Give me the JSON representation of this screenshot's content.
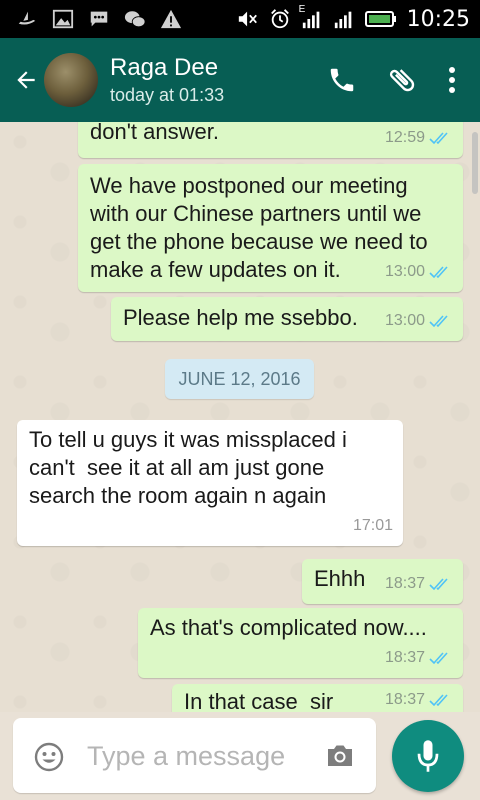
{
  "status_bar": {
    "time": "10:25",
    "network_label": "E",
    "icons": [
      "boat-icon",
      "image-icon",
      "chat-bubble-icon",
      "wechat-icon",
      "warning-icon",
      "mute-icon",
      "alarm-icon",
      "signal-icon",
      "battery-icon"
    ]
  },
  "header": {
    "contact_name": "Raga Dee",
    "last_seen": "today at 01:33",
    "icons": [
      "back-arrow-icon",
      "phone-icon",
      "attach-icon",
      "more-vert-icon"
    ]
  },
  "messages": [
    {
      "direction": "out",
      "text": "don't answer.",
      "time": "12:59",
      "status": "read"
    },
    {
      "direction": "out",
      "text": "We have postponed our meeting\nwith our Chinese partners until we\nget the phone because we need to\nmake a few updates on it.",
      "time": "13:00",
      "status": "read"
    },
    {
      "direction": "out",
      "text": "Please help me ssebbo.",
      "time": "13:00",
      "status": "read"
    },
    {
      "direction": "in",
      "text": "To tell u guys it was missplaced i\ncan't  see it at all am just gone\nsearch the room again n again",
      "time": "17:01"
    },
    {
      "direction": "out",
      "text": "Ehhh",
      "time": "18:37",
      "status": "read"
    },
    {
      "direction": "out",
      "text": "As that's complicated now....",
      "time": "18:37",
      "status": "read"
    },
    {
      "direction": "out",
      "text": "In that case  sir",
      "time": "18:37",
      "status": "read"
    }
  ],
  "date_divider": "JUNE 12, 2016",
  "composer": {
    "placeholder": "Type a message",
    "value": ""
  },
  "colors": {
    "header": "#075e54",
    "outgoing_bubble": "#dcf8c6",
    "incoming_bubble": "#ffffff",
    "read_ticks": "#4fc3f7",
    "mic_button": "#0f8c7f"
  }
}
